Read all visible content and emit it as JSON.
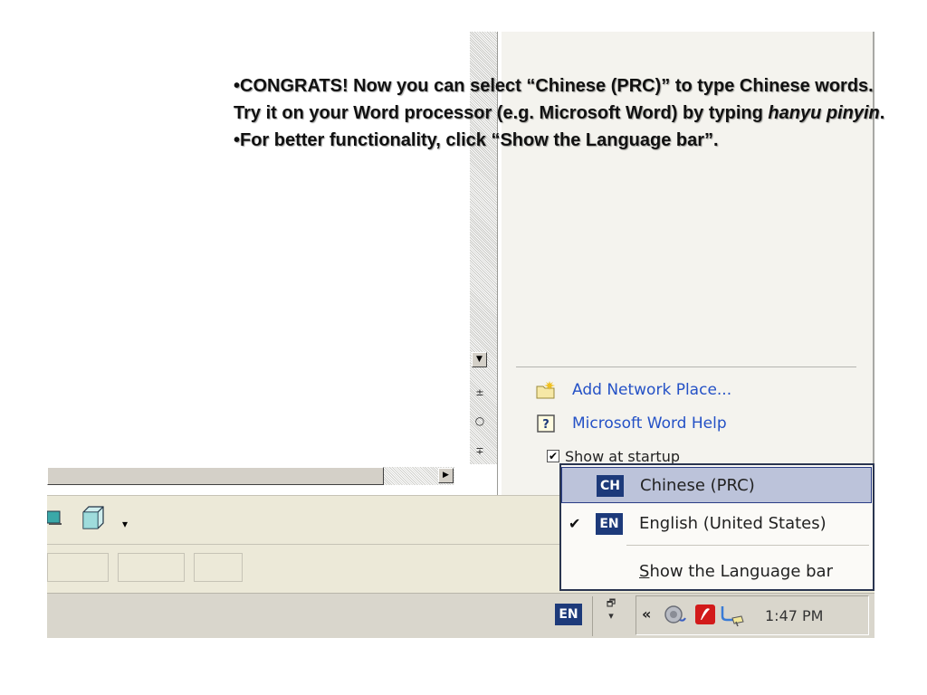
{
  "slide": {
    "bullet1_part1": "•CONGRATS! Now you can select “Chinese (PRC)” to type Chinese words. Try it on your Word processor (e.g. Microsoft Word) by typing ",
    "bullet1_emph": "hanyu pinyin",
    "bullet1_end": ".",
    "bullet2": "•For better functionality, click “Show the Language bar”."
  },
  "word_window": {
    "scroll_down_glyph": "▼",
    "prev_page_glyph": "±",
    "select_browse_glyph": "○",
    "next_page_glyph": "∓",
    "scroll_right_glyph": "▶",
    "drawbar_dropdown_glyph": "▾"
  },
  "task_pane": {
    "add_network_place": "Add Network Place...",
    "word_help": "Microsoft Word Help",
    "show_at_startup": "Show at startup",
    "show_at_startup_checked": true,
    "checkbox_glyph": "✔"
  },
  "language_menu": {
    "items": [
      {
        "badge": "CH",
        "label": "Chinese (PRC)",
        "selected": false,
        "highlighted": true
      },
      {
        "badge": "EN",
        "label": "English (United States)",
        "selected": true,
        "highlighted": false
      }
    ],
    "check_glyph": "✔",
    "show_bar_accel": "S",
    "show_bar_rest": "how the Language bar"
  },
  "taskbar": {
    "lang_indicator": "EN",
    "restore_glyph": "🗗",
    "restore_arrow": "▾",
    "tray_expand": "«",
    "clock": "1:47 PM"
  },
  "colors": {
    "lang_badge_bg": "#1d3a7a",
    "menu_highlight": "#bcc3da",
    "link_blue": "#2451c6",
    "taskbar_bg": "#d9d6cc"
  },
  "icons": {
    "network_place": "folder-network-icon",
    "help": "help-icon",
    "volume": "speaker-icon",
    "tray_app": "red-app-icon",
    "network_tray": "network-connection-icon"
  }
}
